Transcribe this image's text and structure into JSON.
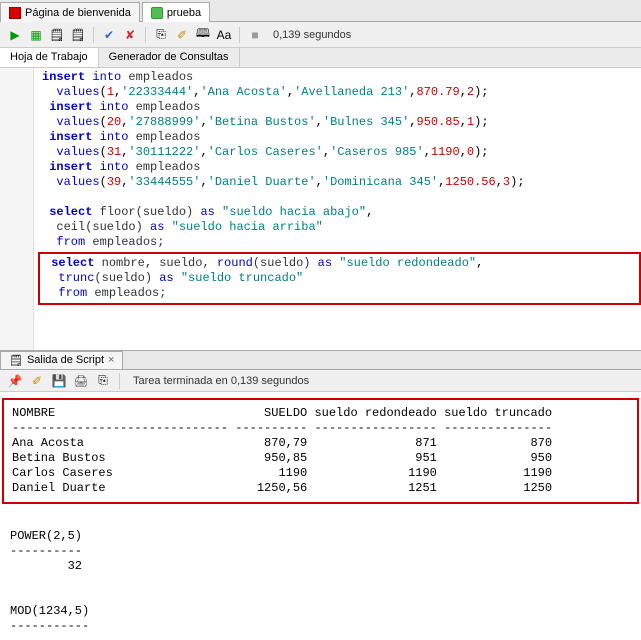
{
  "tabs": {
    "welcome": "Página de bienvenida",
    "prueba": "prueba"
  },
  "toolbar": {
    "timing": "0,139 segundos"
  },
  "subtabs": {
    "worksheet": "Hoja de Trabajo",
    "query_builder": "Generador de Consultas"
  },
  "code": {
    "l1a": "insert",
    "l1b": " into",
    "l1c": " empleados",
    "l2a": "  values",
    "l2b": "(",
    "l2c": "1",
    "l2d": ",",
    "l2e": "'22333444'",
    "l2f": ",",
    "l2g": "'Ana Acosta'",
    "l2h": ",",
    "l2i": "'Avellaneda 213'",
    "l2j": ",",
    "l2k": "870.79",
    "l2l": ",",
    "l2m": "2",
    "l2n": ");",
    "l3a": " insert",
    "l3b": " into",
    "l3c": " empleados",
    "l4a": "  values",
    "l4b": "(",
    "l4c": "20",
    "l4d": ",",
    "l4e": "'27888999'",
    "l4f": ",",
    "l4g": "'Betina Bustos'",
    "l4h": ",",
    "l4i": "'Bulnes 345'",
    "l4j": ",",
    "l4k": "950.85",
    "l4l": ",",
    "l4m": "1",
    "l4n": ");",
    "l5a": " insert",
    "l5b": " into",
    "l5c": " empleados",
    "l6a": "  values",
    "l6b": "(",
    "l6c": "31",
    "l6d": ",",
    "l6e": "'30111222'",
    "l6f": ",",
    "l6g": "'Carlos Caseres'",
    "l6h": ",",
    "l6i": "'Caseros 985'",
    "l6j": ",",
    "l6k": "1190",
    "l6l": ",",
    "l6m": "0",
    "l6n": ");",
    "l7a": " insert",
    "l7b": " into",
    "l7c": " empleados",
    "l8a": "  values",
    "l8b": "(",
    "l8c": "39",
    "l8d": ",",
    "l8e": "'33444555'",
    "l8f": ",",
    "l8g": "'Daniel Duarte'",
    "l8h": ",",
    "l8i": "'Dominicana 345'",
    "l8j": ",",
    "l8k": "1250.56",
    "l8l": ",",
    "l8m": "3",
    "l8n": ");",
    "l10a": " select",
    "l10b": " floor(sueldo) ",
    "l10c": "as",
    "l10d": " \"sueldo hacia abajo\"",
    "l10e": ",",
    "l11a": "  ceil(sueldo) ",
    "l11b": "as",
    "l11c": " \"sueldo hacia arriba\"",
    "l12a": "  from",
    "l12b": " empleados;",
    "l14a": " select",
    "l14b": " nombre, sueldo, ",
    "l14c": "round",
    "l14d": "(sueldo) ",
    "l14e": "as",
    "l14f": " \"sueldo redondeado\"",
    "l14g": ",",
    "l15a": "  trunc",
    "l15b": "(sueldo) ",
    "l15c": "as",
    "l15d": " \"sueldo truncado\"",
    "l16a": "  from",
    "l16b": " empleados;"
  },
  "out_tab": "Salida de Script",
  "out_status": "Tarea terminada en 0,139 segundos",
  "result": {
    "header": "NOMBRE                             SUELDO sueldo redondeado sueldo truncado",
    "sep": "------------------------------ ---------- ----------------- ---------------",
    "r1": "Ana Acosta                         870,79               871             870",
    "r2": "Betina Bustos                      950,85               951             950",
    "r3": "Carlos Caseres                       1190              1190            1190",
    "r4": "Daniel Duarte                     1250,56              1251            1250",
    "pow_lbl": "POWER(2,5)",
    "pow_sep": "----------",
    "pow_val": "        32",
    "mod_lbl": "MOD(1234,5)",
    "mod_sep": "-----------"
  }
}
